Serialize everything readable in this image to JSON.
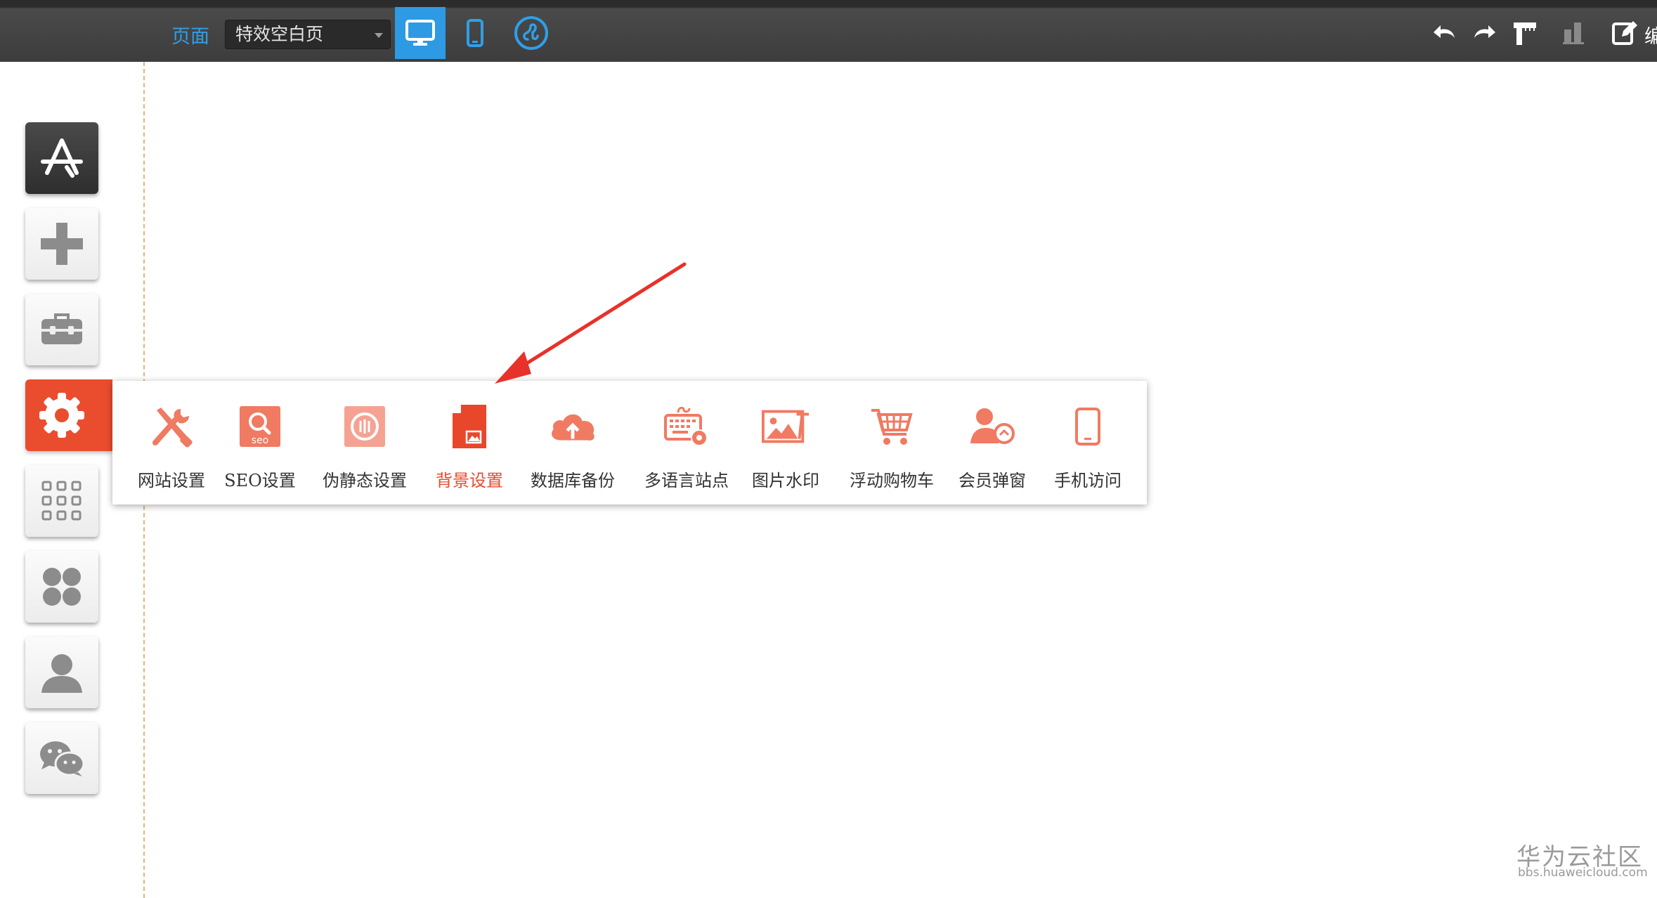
{
  "toolbar": {
    "page_label": "页面",
    "page_select_value": "特效空白页",
    "right_partial_text": "编",
    "colors": {
      "active_view": "#2e9ae4",
      "label": "#2f9fe8",
      "bar": "#3d3d3d"
    },
    "icons": [
      "desktop-icon",
      "mobile-icon",
      "mini-program-icon",
      "undo-icon",
      "redo-icon",
      "ruler-icon",
      "chart-icon",
      "edit-icon"
    ]
  },
  "sidebar": {
    "items": [
      {
        "name": "app-store",
        "icon": "app-store-icon"
      },
      {
        "name": "add",
        "icon": "plus-icon"
      },
      {
        "name": "toolbox",
        "icon": "toolbox-icon"
      },
      {
        "name": "settings",
        "icon": "gear-icon",
        "active": true
      },
      {
        "name": "apps",
        "icon": "grid-icon"
      },
      {
        "name": "plugins",
        "icon": "clover-icon"
      },
      {
        "name": "member",
        "icon": "user-icon"
      },
      {
        "name": "wechat",
        "icon": "wechat-icon"
      }
    ],
    "active_color": "#ea4d2e"
  },
  "settings_menu": {
    "items": [
      {
        "label": "网站设置",
        "icon": "tools-icon"
      },
      {
        "label": "SEO设置",
        "icon": "seo-icon"
      },
      {
        "label": "伪静态设置",
        "icon": "static-url-icon"
      },
      {
        "label": "背景设置",
        "icon": "background-file-icon",
        "selected": true
      },
      {
        "label": "数据库备份",
        "icon": "cloud-upload-icon"
      },
      {
        "label": "多语言站点",
        "icon": "keyboard-gear-icon"
      },
      {
        "label": "图片水印",
        "icon": "image-watermark-icon"
      },
      {
        "label": "浮动购物车",
        "icon": "cart-icon"
      },
      {
        "label": "会员弹窗",
        "icon": "member-popup-icon"
      },
      {
        "label": "手机访问",
        "icon": "phone-icon"
      }
    ],
    "icon_color": "#f07a62",
    "selected_color": "#e84a2c"
  },
  "annotation": {
    "arrow_color": "#e8312a"
  },
  "watermark": {
    "title": "华为云社区",
    "url": "bbs.huaweicloud.com"
  }
}
